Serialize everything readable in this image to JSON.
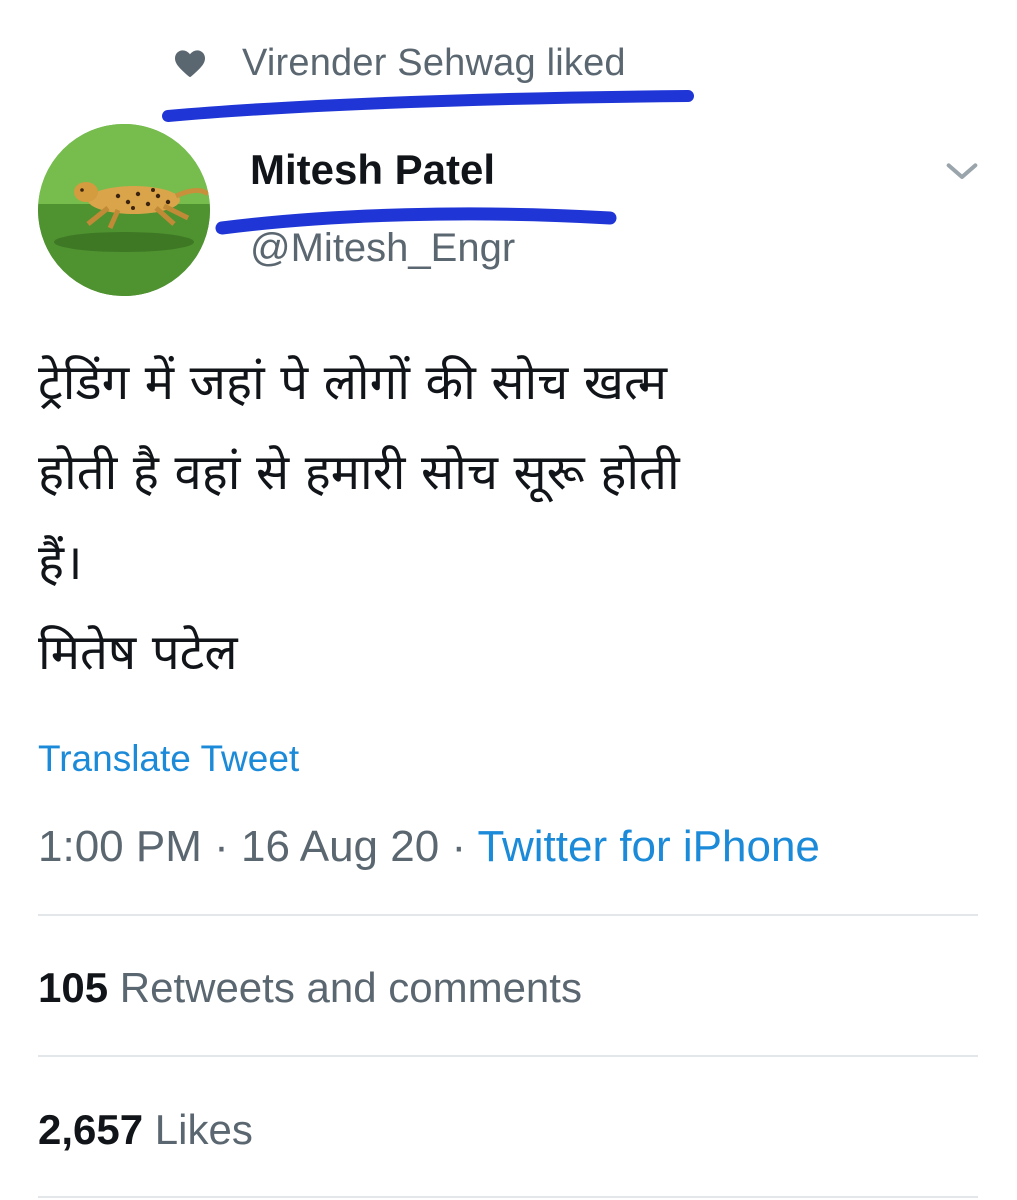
{
  "social_context": {
    "icon": "heart-icon",
    "text": "Virender Sehwag liked"
  },
  "author": {
    "display_name": "Mitesh Patel",
    "handle": "@Mitesh_Engr",
    "avatar": "cheetah-running-avatar"
  },
  "tweet": {
    "text": "ट्रेडिंग में जहां पे लोगों की सोच खत्म\nहोती है वहां से हमारी सोच सूरू होती\nहैं।\nमितेष पटेल",
    "translate_label": "Translate Tweet"
  },
  "meta": {
    "time": "1:00 PM",
    "date": "16 Aug 20",
    "source": "Twitter for iPhone",
    "separator": "·"
  },
  "stats": {
    "retweets_count": "105",
    "retweets_label": "Retweets and comments",
    "likes_count": "2,657",
    "likes_label": "Likes"
  },
  "colors": {
    "link": "#1b8ad8",
    "secondary_text": "#5b6770",
    "annotation_marker": "#1f35d6"
  }
}
